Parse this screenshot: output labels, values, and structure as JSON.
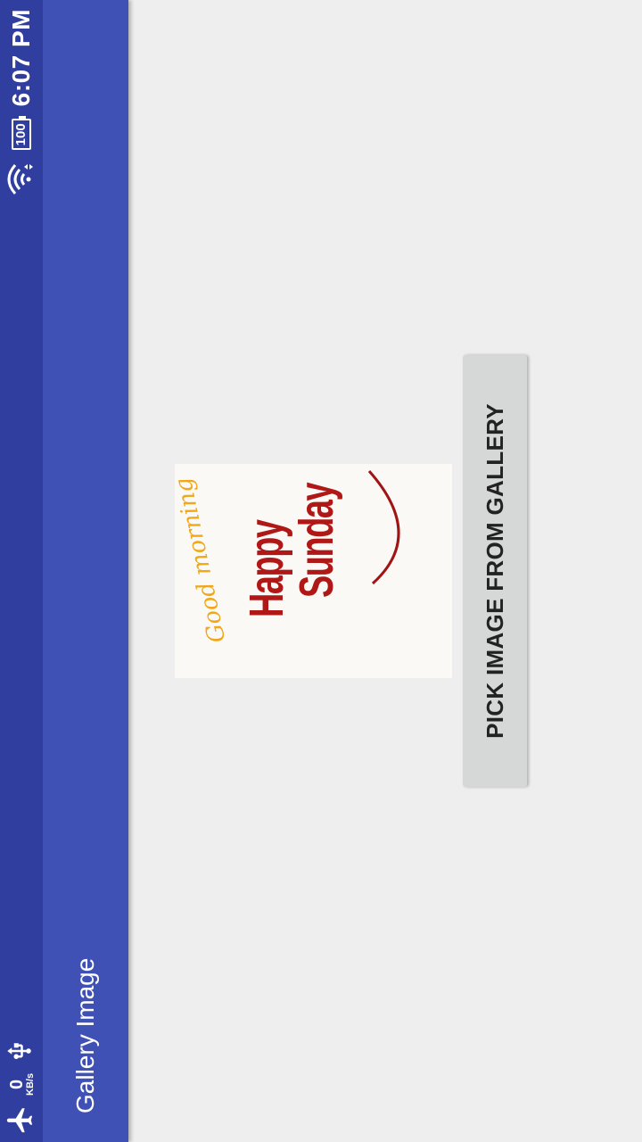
{
  "status_bar": {
    "network_speed_value": "0",
    "network_speed_unit": "KB/s",
    "battery_level": "100",
    "time": "6:07 PM",
    "icons": [
      "airplane-icon",
      "usb-icon",
      "wifi-icon",
      "battery-icon"
    ]
  },
  "app_bar": {
    "title": "Gallery Image"
  },
  "image": {
    "line1": "Good morning",
    "line2": "Happy",
    "line3": "Sunday"
  },
  "button": {
    "label": "PICK IMAGE FROM GALLERY"
  },
  "colors": {
    "status_bar": "#303f9f",
    "app_bar": "#3f51b5",
    "background": "#eeeeee",
    "button": "#d6d7d7"
  }
}
